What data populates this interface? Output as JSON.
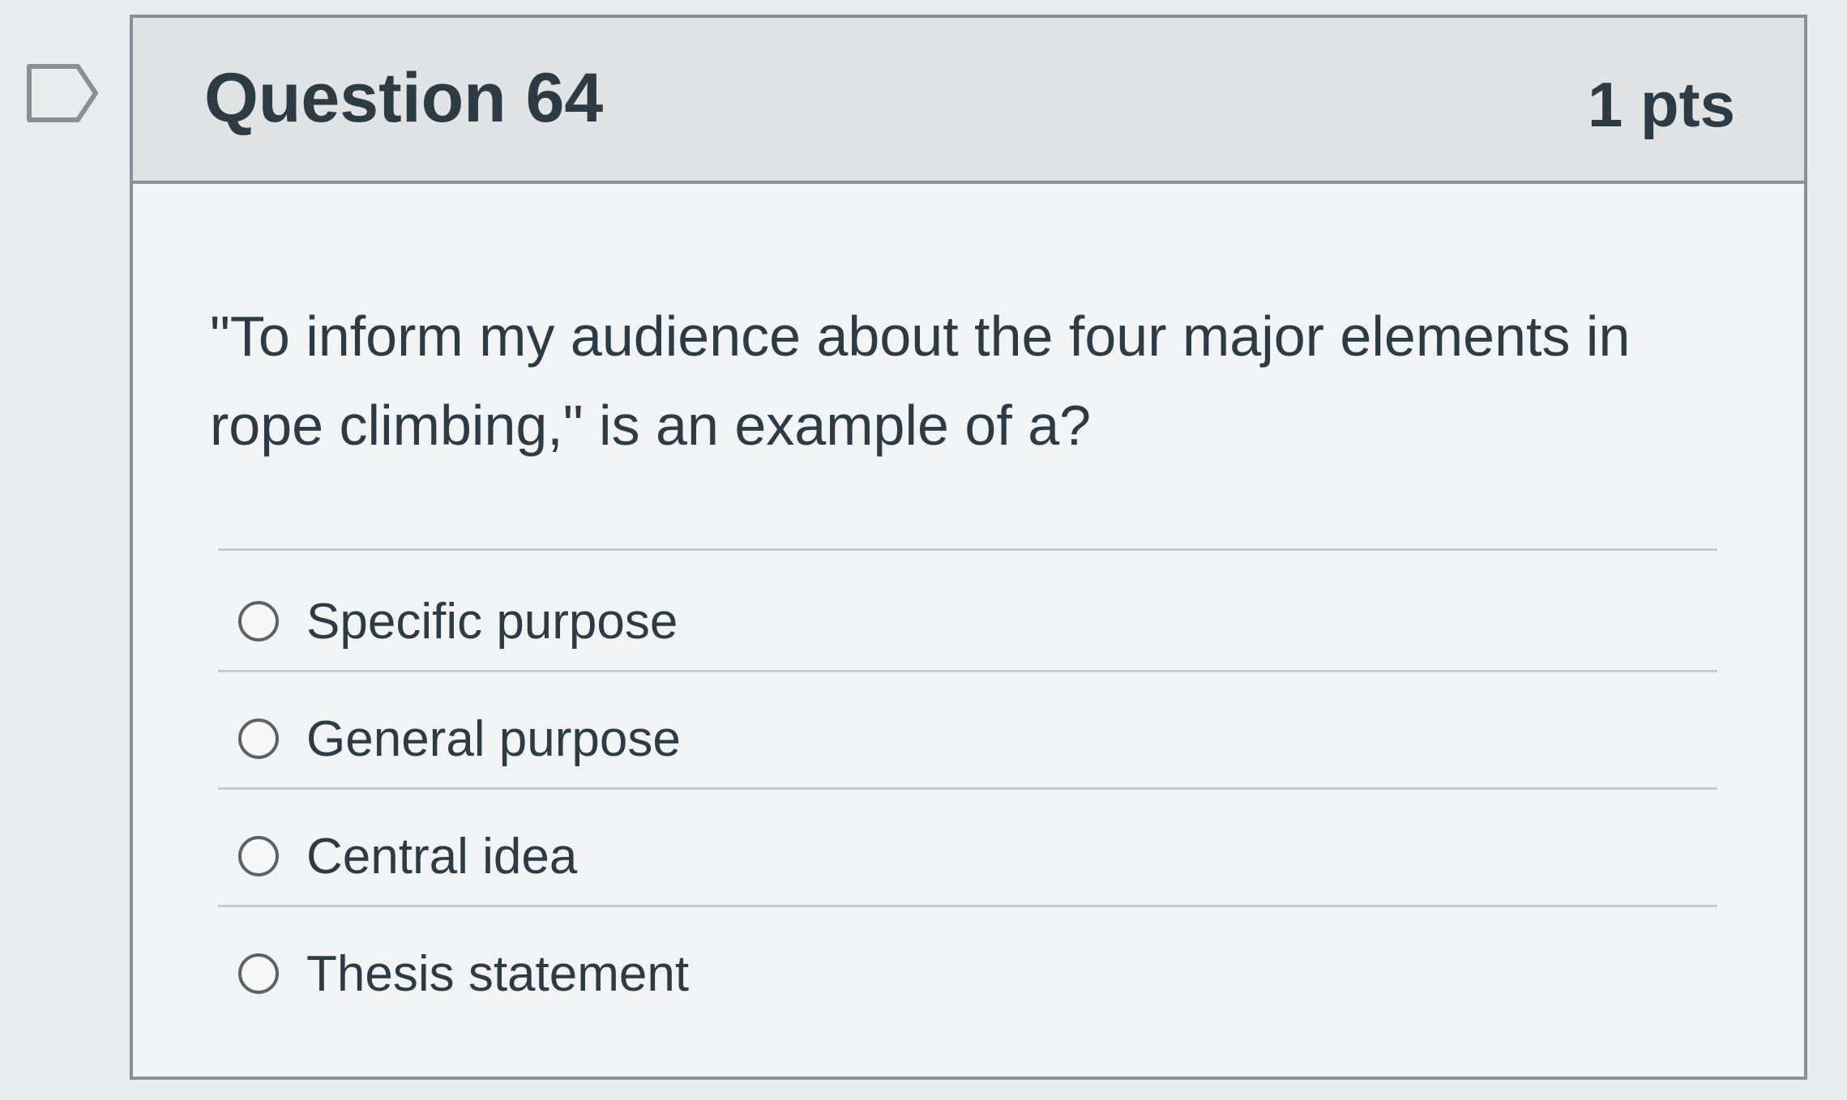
{
  "question": {
    "title": "Question 64",
    "points": "1 pts",
    "text": "\"To inform my audience about the four major elements in rope climbing,\" is an example of a?",
    "answers": [
      {
        "label": "Specific purpose",
        "selected": false
      },
      {
        "label": "General purpose",
        "selected": false
      },
      {
        "label": "Central idea",
        "selected": false
      },
      {
        "label": "Thesis statement",
        "selected": false
      }
    ]
  },
  "flag": {
    "icon": "flag-outline-icon"
  }
}
